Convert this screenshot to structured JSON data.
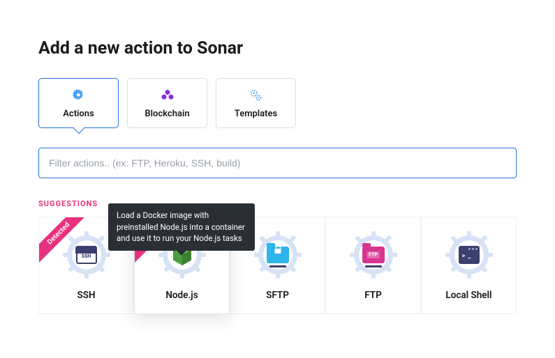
{
  "title": "Add a new action to Sonar",
  "tabs": [
    {
      "label": "Actions",
      "icon": "gear-icon",
      "active": true
    },
    {
      "label": "Blockchain",
      "icon": "cubes-icon",
      "active": false
    },
    {
      "label": "Templates",
      "icon": "gears-icon",
      "active": false
    }
  ],
  "filter": {
    "value": "",
    "placeholder": "Filter actions.. (ex: FTP, Heroku, SSH, build)"
  },
  "suggestions_label": "SUGGESTIONS",
  "ribbon_text": "Detected",
  "tooltip": "Load a Docker image with preinstalled Node.js into a container and use it to run your Node.js tasks",
  "cards": [
    {
      "title": "SSH",
      "detected": true
    },
    {
      "title": "Node.js",
      "detected": true,
      "hover": true
    },
    {
      "title": "SFTP",
      "detected": false
    },
    {
      "title": "FTP",
      "detected": false
    },
    {
      "title": "Local Shell",
      "detected": false
    }
  ],
  "colors": {
    "primary": "#1f6fde",
    "accent": "#e8317e",
    "gear": "#d6e3f6"
  }
}
